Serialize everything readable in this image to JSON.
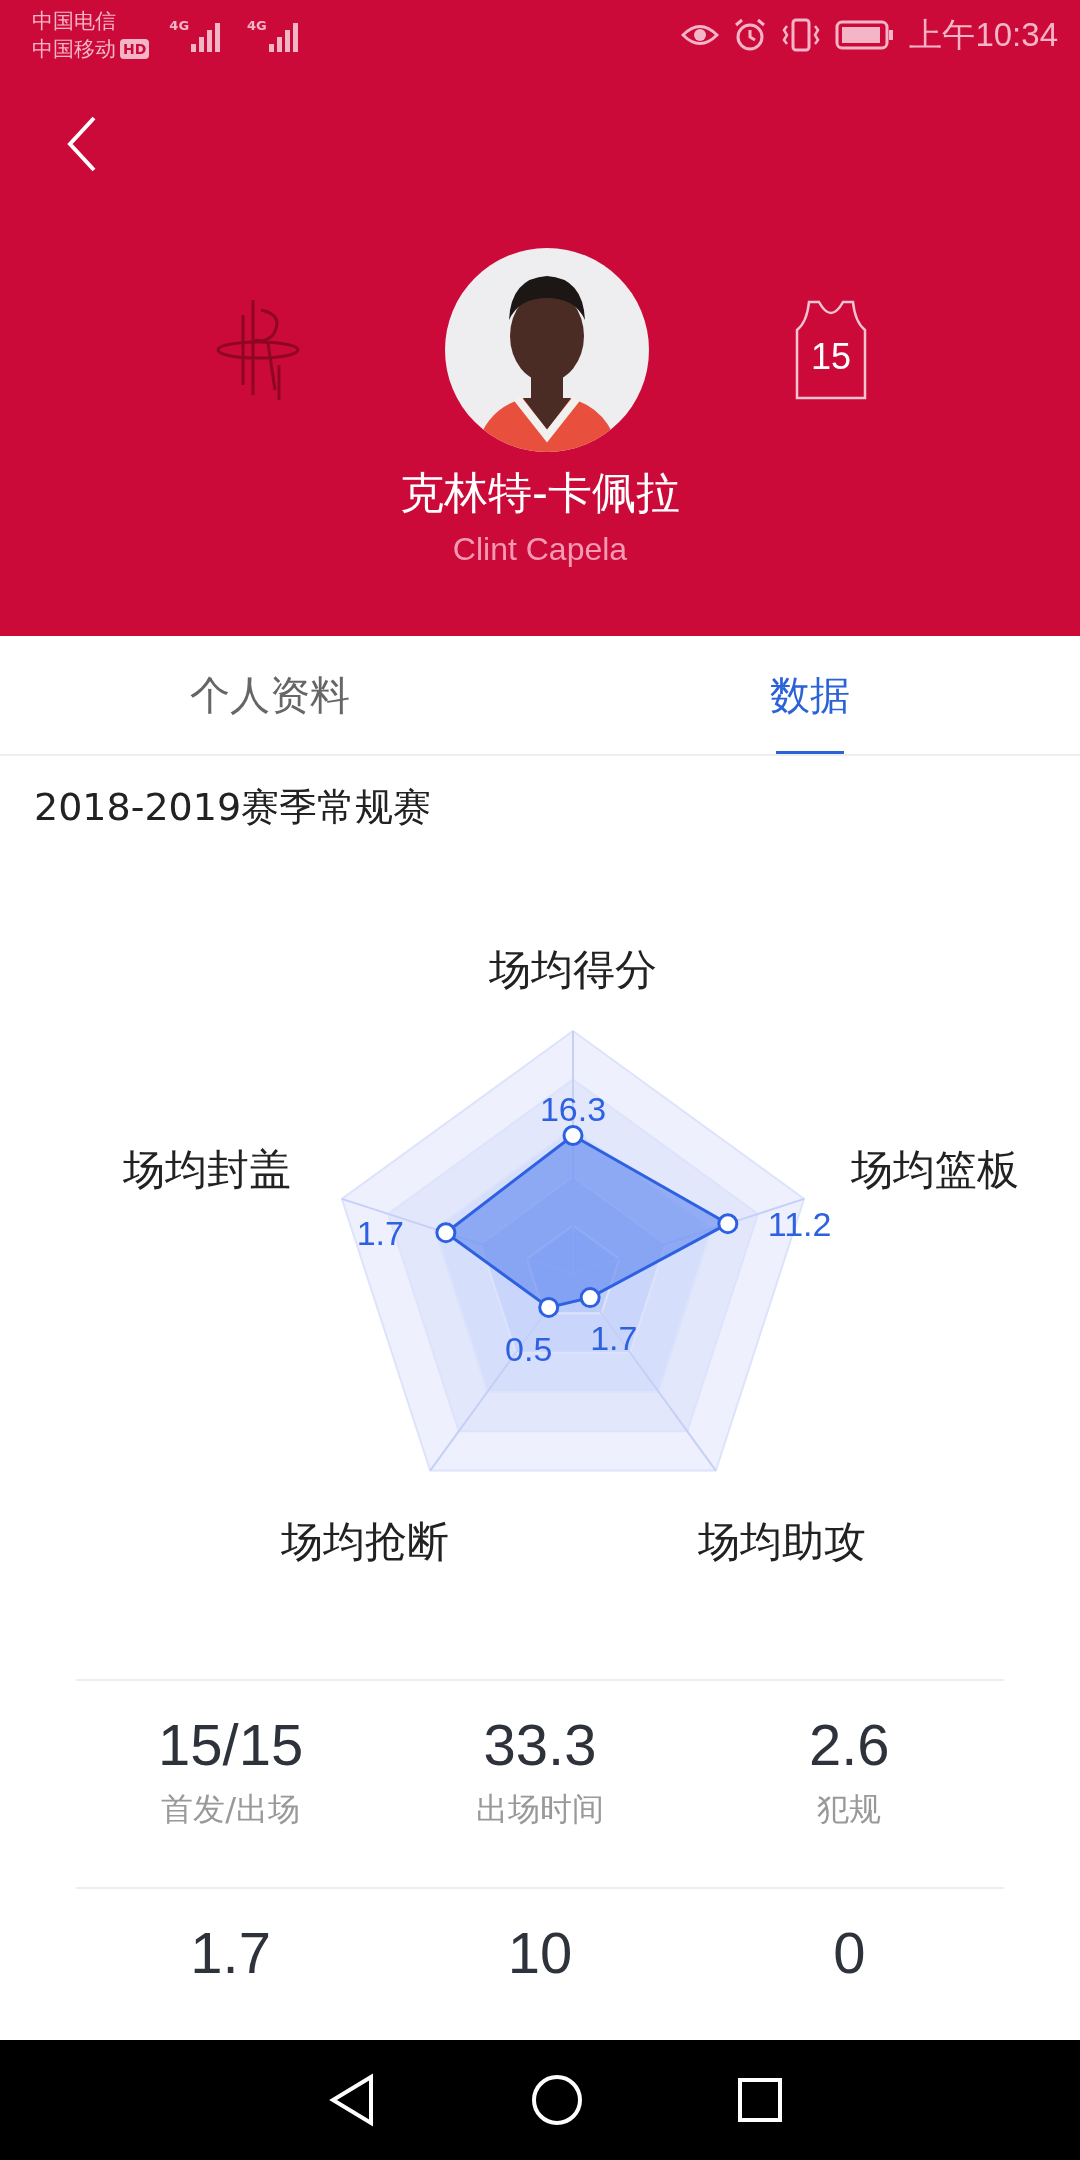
{
  "status_bar": {
    "carriers": [
      "中国电信",
      "中国移动"
    ],
    "hd_badge": "HD",
    "network": [
      "4G",
      "4G"
    ],
    "time": "上午10:34"
  },
  "player": {
    "name": "克林特-卡佩拉",
    "english_name": "Clint Capela",
    "number": "15"
  },
  "tabs": [
    {
      "label": "个人资料",
      "selected": false
    },
    {
      "label": "数据",
      "selected": true
    }
  ],
  "section_title": "2018-2019赛季常规赛",
  "radar": {
    "axes": [
      {
        "label": "场均得分",
        "value": "16.3"
      },
      {
        "label": "场均封盖",
        "value": "1.7"
      },
      {
        "label": "场均篮板",
        "value": "11.2"
      },
      {
        "label": "场均抢断",
        "value": "0.5"
      },
      {
        "label": "场均助攻",
        "value": "1.7"
      }
    ]
  },
  "stats": [
    [
      {
        "value": "15/15",
        "label": "首发/出场"
      },
      {
        "value": "33.3",
        "label": "出场时间"
      },
      {
        "value": "2.6",
        "label": "犯规"
      }
    ],
    [
      {
        "value": "1.7"
      },
      {
        "value": "10"
      },
      {
        "value": "0"
      }
    ]
  ]
}
